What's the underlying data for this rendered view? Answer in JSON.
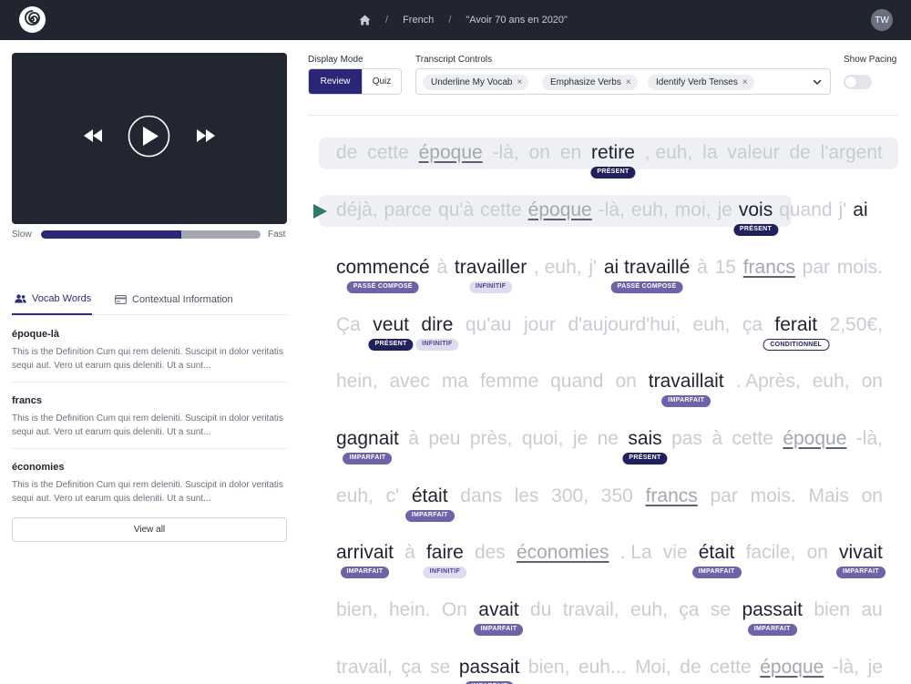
{
  "app": {
    "avatar_initials": "TW"
  },
  "breadcrumb": {
    "home_icon": "home-icon",
    "language": "French",
    "lesson": "\"Avoir 70 ans en 2020\""
  },
  "player": {
    "speed_slow": "Slow",
    "speed_fast": "Fast",
    "speed_level_percent": 64
  },
  "tabs": {
    "vocab": "Vocab Words",
    "context": "Contextual Information"
  },
  "vocab": [
    {
      "term": "époque-là",
      "def": "This is the Definition Cum qui rem deleniti. Suscipit in dolor veritatis sequi aut. Vero ut earum quis deleniti. Ut a sunt..."
    },
    {
      "term": "francs",
      "def": "This is the Definition Cum qui rem deleniti. Suscipit in dolor veritatis sequi aut. Vero ut earum quis deleniti. Ut a sunt..."
    },
    {
      "term": "économies",
      "def": "This is the Definition Cum qui rem deleniti. Suscipit in dolor veritatis sequi aut. Vero ut earum quis deleniti. Ut a sunt..."
    }
  ],
  "view_all": "View all",
  "controls": {
    "display_mode_label": "Display Mode",
    "review": "Review",
    "quiz": "Quiz",
    "transcript_label": "Transcript Controls",
    "chips": [
      "Underline My Vocab",
      "Emphasize Verbs",
      "Identify Verb Tenses"
    ],
    "chip_remove": "×",
    "pacing_label": "Show Pacing",
    "pacing_on": false
  },
  "transcript": [
    {
      "words": [
        {
          "t": "de"
        },
        {
          "t": "cette"
        },
        {
          "t": "époque",
          "u": true
        },
        {
          "t": "-là,"
        },
        {
          "t": "on"
        },
        {
          "t": "en"
        },
        {
          "t": "retire",
          "on": true,
          "badge": "PRÉSENT",
          "bt": "present"
        },
        {
          "t": ", euh,"
        },
        {
          "t": "la"
        },
        {
          "t": "valeur"
        },
        {
          "t": "de"
        },
        {
          "t": "l'argent"
        }
      ]
    },
    {
      "words": [
        {
          "t": "déjà,"
        },
        {
          "t": "parce"
        },
        {
          "t": "qu'à"
        },
        {
          "t": "cette"
        },
        {
          "t": "époque",
          "u": true
        },
        {
          "t": "-là,"
        },
        {
          "t": "euh,"
        },
        {
          "t": "moi,"
        },
        {
          "t": "je"
        },
        {
          "t": "vois",
          "on": true,
          "badge": "PRÉSENT",
          "bt": "present"
        },
        {
          "t": "quand"
        },
        {
          "t": "j'"
        },
        {
          "t": "ai",
          "on": true
        }
      ]
    },
    {
      "words": [
        {
          "t": "commencé",
          "on": true,
          "badge": "PASSÉ COMPOSÉ",
          "bt": "passe"
        },
        {
          "t": "à"
        },
        {
          "t": "travailler",
          "on": true,
          "badge": "INFINITIF",
          "bt": "infinitif"
        },
        {
          "t": ", euh,"
        },
        {
          "t": "j'"
        },
        {
          "t": "ai travaillé",
          "on": true,
          "badge": "PASSÉ COMPOSÉ",
          "bt": "passe"
        },
        {
          "t": "à"
        },
        {
          "t": "15"
        },
        {
          "t": "francs",
          "u": true
        },
        {
          "t": "par"
        },
        {
          "t": "mois."
        }
      ]
    },
    {
      "words": [
        {
          "t": "Ça"
        },
        {
          "t": "veut",
          "on": true,
          "badge": "PRÉSENT",
          "bt": "present"
        },
        {
          "t": "dire",
          "on": true,
          "badge": "INFINITIF",
          "bt": "infinitif"
        },
        {
          "t": "qu'au"
        },
        {
          "t": "jour"
        },
        {
          "t": "d'aujourd'hui,"
        },
        {
          "t": "euh,"
        },
        {
          "t": "ça"
        },
        {
          "t": "ferait",
          "on": true,
          "badge": "CONDITIONNEL",
          "bt": "cond"
        },
        {
          "t": "2,50€,"
        }
      ]
    },
    {
      "words": [
        {
          "t": "hein,"
        },
        {
          "t": "avec"
        },
        {
          "t": "ma"
        },
        {
          "t": "femme"
        },
        {
          "t": "quand"
        },
        {
          "t": "on"
        },
        {
          "t": "travaillait",
          "on": true,
          "badge": "IMPARFAIT",
          "bt": "imparfait"
        },
        {
          "t": ". Après,"
        },
        {
          "t": "euh,"
        },
        {
          "t": "on"
        }
      ]
    },
    {
      "words": [
        {
          "t": "gagnait",
          "on": true,
          "badge": "IMPARFAIT",
          "bt": "imparfait"
        },
        {
          "t": "à"
        },
        {
          "t": "peu"
        },
        {
          "t": "près,"
        },
        {
          "t": "quoi,"
        },
        {
          "t": "je"
        },
        {
          "t": "ne"
        },
        {
          "t": "sais",
          "on": true,
          "badge": "PRÉSENT",
          "bt": "present"
        },
        {
          "t": "pas"
        },
        {
          "t": "à"
        },
        {
          "t": "cette"
        },
        {
          "t": "époque",
          "u": true
        },
        {
          "t": "-là,"
        }
      ]
    },
    {
      "words": [
        {
          "t": "euh,"
        },
        {
          "t": "c'"
        },
        {
          "t": "était",
          "on": true,
          "badge": "IMPARFAIT",
          "bt": "imparfait"
        },
        {
          "t": "dans"
        },
        {
          "t": "les"
        },
        {
          "t": "300,"
        },
        {
          "t": "350"
        },
        {
          "t": "francs",
          "u": true
        },
        {
          "t": "par"
        },
        {
          "t": "mois."
        },
        {
          "t": "Mais"
        },
        {
          "t": "on"
        }
      ]
    },
    {
      "words": [
        {
          "t": "arrivait",
          "on": true,
          "badge": "IMPARFAIT",
          "bt": "imparfait"
        },
        {
          "t": "à"
        },
        {
          "t": "faire",
          "on": true,
          "badge": "INFINITIF",
          "bt": "infinitif"
        },
        {
          "t": "des"
        },
        {
          "t": "économies",
          "u": true
        },
        {
          "t": ". La"
        },
        {
          "t": "vie"
        },
        {
          "t": "était",
          "on": true,
          "badge": "IMPARFAIT",
          "bt": "imparfait"
        },
        {
          "t": "facile,"
        },
        {
          "t": "on"
        },
        {
          "t": "vivait",
          "on": true,
          "badge": "IMPARFAIT",
          "bt": "imparfait"
        }
      ]
    },
    {
      "words": [
        {
          "t": "bien,"
        },
        {
          "t": "hein."
        },
        {
          "t": "On"
        },
        {
          "t": "avait",
          "on": true,
          "badge": "IMPARFAIT",
          "bt": "imparfait"
        },
        {
          "t": "du"
        },
        {
          "t": "travail,"
        },
        {
          "t": "euh,"
        },
        {
          "t": "ça"
        },
        {
          "t": "se"
        },
        {
          "t": "passait",
          "on": true,
          "badge": "IMPARFAIT",
          "bt": "imparfait"
        },
        {
          "t": "bien"
        },
        {
          "t": "au"
        }
      ]
    },
    {
      "words": [
        {
          "t": "travail,"
        },
        {
          "t": "ça"
        },
        {
          "t": "se"
        },
        {
          "t": "passait",
          "on": true,
          "badge": "IMPARFAIT",
          "bt": "imparfait"
        },
        {
          "t": "bien,"
        },
        {
          "t": "euh..."
        },
        {
          "t": "Moi,"
        },
        {
          "t": "de"
        },
        {
          "t": "cette"
        },
        {
          "t": "époque",
          "u": true
        },
        {
          "t": "-là,"
        },
        {
          "t": "je"
        }
      ]
    }
  ]
}
